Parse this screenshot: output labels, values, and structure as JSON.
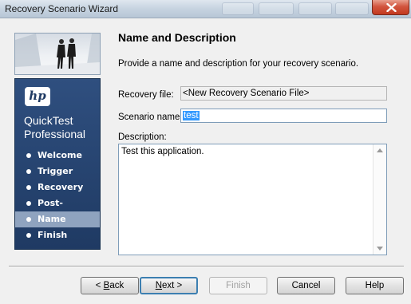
{
  "window": {
    "title": "Recovery Scenario Wizard"
  },
  "banner": {
    "logo_text": "hp",
    "product_line1": "QuickTest",
    "product_line2": "Professional",
    "steps": [
      {
        "label": "Welcome",
        "active": false
      },
      {
        "label": "Trigger",
        "active": false
      },
      {
        "label": "Recovery",
        "active": false
      },
      {
        "label": "Post-recovery",
        "active": false
      },
      {
        "label": "Name",
        "active": true
      },
      {
        "label": "Finish",
        "active": false
      }
    ]
  },
  "page": {
    "title": "Name and Description",
    "description": "Provide a name and description for your recovery scenario.",
    "recovery_file_label": "Recovery file:",
    "recovery_file_value": "<New Recovery Scenario File>",
    "scenario_name_label": "Scenario name:",
    "scenario_name_value": "test",
    "description_label": "Description:",
    "description_value": "Test this application."
  },
  "buttons": {
    "back_mnemonic": "B",
    "back_rest": "ack",
    "back_prefix": "< ",
    "next_mnemonic": "N",
    "next_rest": "ext >",
    "finish": "Finish",
    "cancel": "Cancel",
    "help": "Help"
  },
  "colors": {
    "banner": "#1f3a63",
    "active_step": "#8fa3bf",
    "selection": "#3399ff",
    "close": "#c2391f"
  }
}
